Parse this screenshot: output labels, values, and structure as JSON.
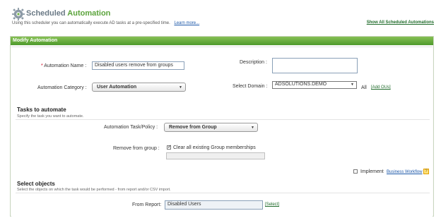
{
  "header": {
    "title_part1": "Scheduled",
    "title_part2": "Automation",
    "subtitle": "Using this scheduler you can automatically execute AD tasks at a pre-specified time.",
    "learn_more": "Learn more...",
    "show_all": "Show All Scheduled Automations"
  },
  "panel": {
    "title": "Modify Automation"
  },
  "form": {
    "automation_name_label": "Automation Name :",
    "automation_name_value": "Disabled users remove from groups",
    "description_label": "Description :",
    "description_value": "",
    "category_label": "Automation Category :",
    "category_value": "User Automation",
    "domain_label": "Select Domain :",
    "domain_value": "ADSOLUTIONS.DEMO",
    "domain_all": "All",
    "add_ous": "[Add OUs]"
  },
  "tasks": {
    "heading": "Tasks to automate",
    "description": "Specify the task you want to automate.",
    "task_label": "Automation Task/Policy :",
    "task_value": "Remove from Group",
    "remove_label": "Remove from group :",
    "clear_label": "Clear all existing Group memberships",
    "clear_checked": true,
    "implement_label": "Implement",
    "business_workflow": "Business Workflow"
  },
  "objects": {
    "heading": "Select objects",
    "description": "Select the objects on which the task would be performed - from report and/or CSV import.",
    "from_report_label": "From Report:",
    "from_report_value": "Disabled Users",
    "select_link": "[Select]"
  },
  "colors": {
    "accent_green": "#5aa33a",
    "panel_bar": "#6fb244",
    "link_green": "#1f6b2a",
    "required_red": "#d0021b"
  }
}
